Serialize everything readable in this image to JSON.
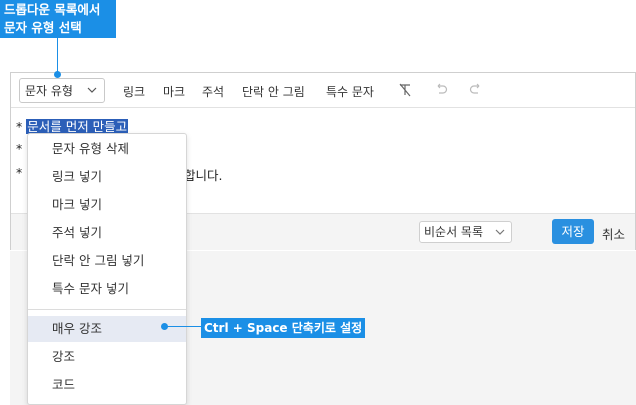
{
  "callout_top": {
    "line1": "드롭다운 목록에서",
    "line2": "문자 유형 선택"
  },
  "callout_right": {
    "text": "Ctrl + Space 단축키로 설정"
  },
  "toolbar": {
    "dropdown_label": "문자 유형",
    "items": [
      "링크",
      "마크",
      "주석",
      "단락 안 그림",
      "특수 문자"
    ],
    "icons": [
      "clear-format-icon",
      "undo-icon",
      "redo-icon"
    ]
  },
  "content": {
    "lines": [
      {
        "bullet": "*",
        "text": "문서를 먼저 만들고"
      },
      {
        "bullet": "*",
        "text": ""
      },
      {
        "bullet": "*",
        "text": "합니다."
      }
    ]
  },
  "menu": {
    "items": [
      "문자 유형 삭제",
      "링크 넣기",
      "마크 넣기",
      "주석 넣기",
      "단락 안 그림 넣기",
      "특수 문자 넣기"
    ],
    "styles": [
      "매우 강조",
      "강조",
      "코드"
    ]
  },
  "footer": {
    "list_select": "비순서 목록",
    "save_label": "저장",
    "cancel_label": "취소"
  },
  "colors": {
    "accent": "#1b8fe6",
    "selection": "#2c5fb8",
    "save_button": "#2a90e0"
  }
}
